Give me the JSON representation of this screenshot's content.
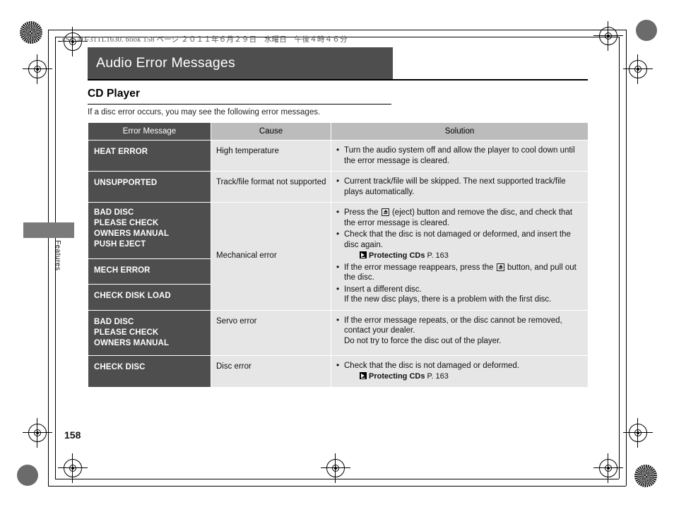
{
  "page": {
    "running_header": "TSX 4D-31TL1630. book  158 ページ  ２０１１年６月２９日　水曜日　午後４時４６分",
    "section_title": "Audio Error Messages",
    "subsection_title": "CD Player",
    "intro_text": "If a disc error occurs, you may see the following error messages.",
    "side_tab_label": "Features",
    "page_number": "158"
  },
  "table": {
    "headers": [
      "Error Message",
      "Cause",
      "Solution"
    ],
    "rows": [
      {
        "error_messages": [
          "HEAT ERROR"
        ],
        "cause": "High temperature",
        "solution": [
          {
            "text": "Turn the audio system off and allow the player to cool down until the error message is cleared."
          }
        ]
      },
      {
        "error_messages": [
          "UNSUPPORTED"
        ],
        "cause": "Track/file format not supported",
        "solution": [
          {
            "text": "Current track/file will be skipped. The next supported track/file plays automatically."
          }
        ]
      },
      {
        "error_messages": [
          "BAD DISC\nPLEASE CHECK\nOWNERS MANUAL\nPUSH EJECT",
          "MECH ERROR",
          "CHECK DISK LOAD"
        ],
        "cause": "Mechanical error",
        "solution": [
          {
            "pre": "Press the ",
            "icon": "eject-icon",
            "post": " (eject) button and remove the disc, and check that the error message is cleared."
          },
          {
            "text": "Check that the disc is not damaged or deformed, and insert the disc again.",
            "ref": {
              "icon": "reference-icon",
              "label": "Protecting CDs",
              "page": "P. 163"
            }
          },
          {
            "pre": "If the error message reappears, press the ",
            "icon": "eject-icon",
            "post": " button, and pull out the disc."
          },
          {
            "text": "Insert a different disc.",
            "sub": "If the new disc plays, there is a problem with the first disc."
          }
        ]
      },
      {
        "error_messages": [
          "BAD DISC\nPLEASE CHECK\nOWNERS MANUAL"
        ],
        "cause": "Servo error",
        "solution": [
          {
            "text": "If the error message repeats, or the disc cannot be removed, contact your dealer.",
            "sub": "Do not try to force the disc out of the player."
          }
        ]
      },
      {
        "error_messages": [
          "CHECK DISC"
        ],
        "cause": "Disc error",
        "solution": [
          {
            "text": "Check that the disc is not damaged or deformed.",
            "ref": {
              "icon": "reference-icon",
              "label": "Protecting CDs",
              "page": "P. 163"
            }
          }
        ]
      }
    ]
  },
  "colors": {
    "dark_gray": "#4e4e4e",
    "header_gray": "#bcbcbc",
    "cell_gray": "#e6e6e6",
    "tab_gray": "#7a7a7a"
  }
}
